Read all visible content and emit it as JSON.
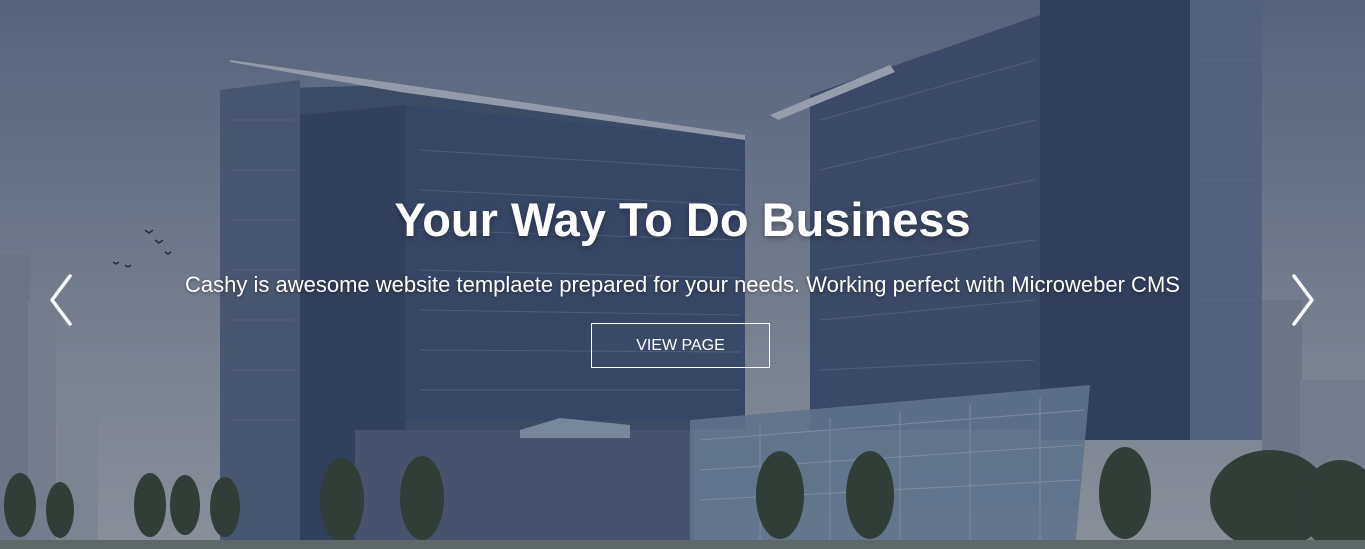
{
  "hero": {
    "title": "Your Way To Do Business",
    "subtitle": "Cashy is awesome website templaete prepared for your needs. Working perfect with Microweber CMS",
    "button_label": "VIEW PAGE",
    "prev_icon": "chevron-left-icon",
    "next_icon": "chevron-right-icon",
    "background_image": "city-office-buildings-photo"
  },
  "colors": {
    "text": "#ffffff",
    "overlay": "#1e2a3c",
    "sky_top": "#6f7f97",
    "building": "#4a5a78"
  }
}
